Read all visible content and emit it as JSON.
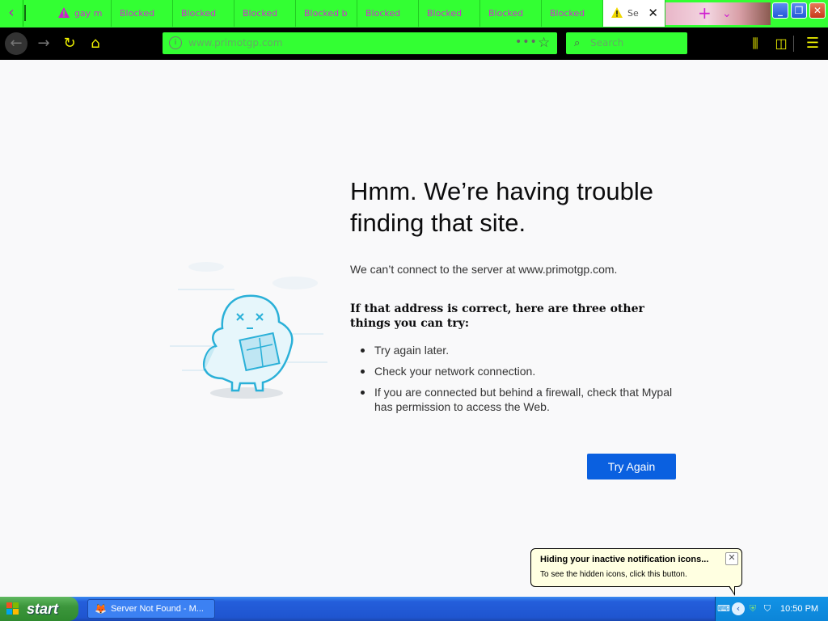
{
  "browser": {
    "tabs": [
      {
        "label": "gay m",
        "warning": true
      },
      {
        "label": "Blocked"
      },
      {
        "label": "Blocked"
      },
      {
        "label": "Blocked"
      },
      {
        "label": "Blocked b"
      },
      {
        "label": "Blocked"
      },
      {
        "label": "Blocked"
      },
      {
        "label": "Blocked"
      },
      {
        "label": "Blocked"
      },
      {
        "label": "Se",
        "warning": true,
        "active": true
      }
    ],
    "url": "www.primotgp.com",
    "search_placeholder": "Search",
    "theme_colors": {
      "chrome": "#33ff33",
      "toolbar": "#000000",
      "icons": "#eef000",
      "tab_text": "#cc33cc"
    }
  },
  "error_page": {
    "title": "Hmm. We’re having trouble finding that site.",
    "description": "We can’t connect to the server at www.primotgp.com.",
    "try_heading": "If that address is correct, here are three other things you can try:",
    "suggestions": [
      "Try again later.",
      "Check your network connection.",
      "If you are connected but behind a firewall, check that Mypal has permission to access the Web."
    ],
    "try_again_label": "Try Again",
    "button_color": "#0a60e0"
  },
  "notification": {
    "title": "Hiding your inactive notification icons...",
    "text": "To see the hidden icons, click this button."
  },
  "taskbar": {
    "start_label": "start",
    "task_item": "Server Not Found - M...",
    "clock": "10:50 PM"
  }
}
